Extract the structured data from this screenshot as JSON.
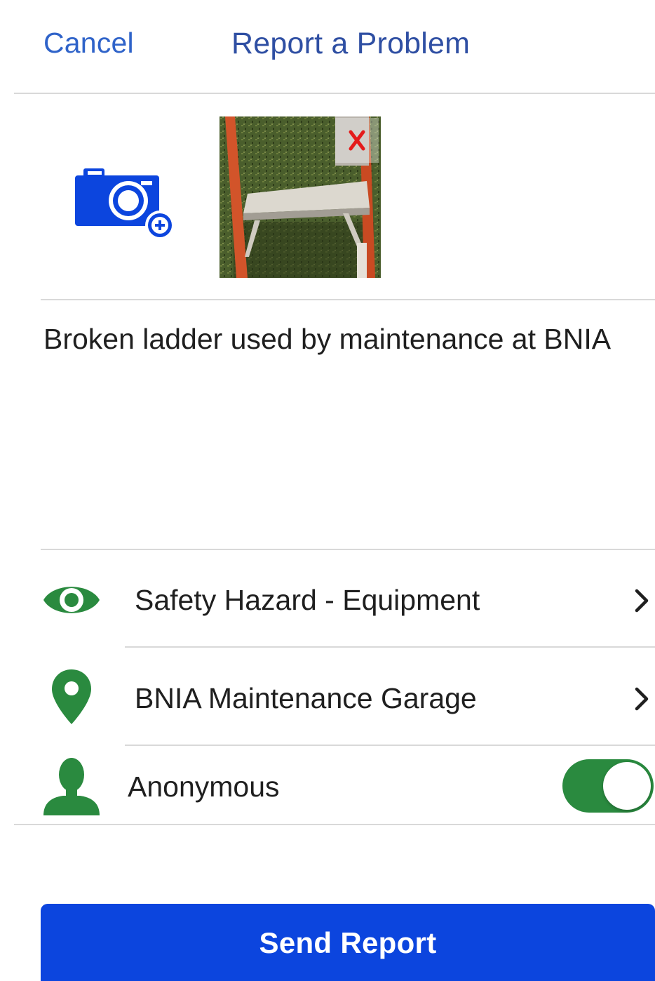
{
  "header": {
    "cancel_label": "Cancel",
    "title": "Report a Problem"
  },
  "photos": {
    "add_icon": "camera-plus-icon",
    "remove_label": "X"
  },
  "description": {
    "text": "Broken ladder used by maintenance at BNIA"
  },
  "rows": [
    {
      "icon": "eye-icon",
      "label": "Safety Hazard - Equipment",
      "chevron": "chevron-right-icon"
    },
    {
      "icon": "location-pin-icon",
      "label": "BNIA Maintenance Garage",
      "chevron": "chevron-right-icon"
    },
    {
      "icon": "person-icon",
      "label": "Anonymous",
      "toggle_on": true
    }
  ],
  "footer": {
    "send_label": "Send Report"
  },
  "colors": {
    "header_link": "#2f63c9",
    "title": "#2f4fa3",
    "icon_blue": "#0c45de",
    "icon_green": "#2a8a3f",
    "send_button": "#0c45de"
  }
}
